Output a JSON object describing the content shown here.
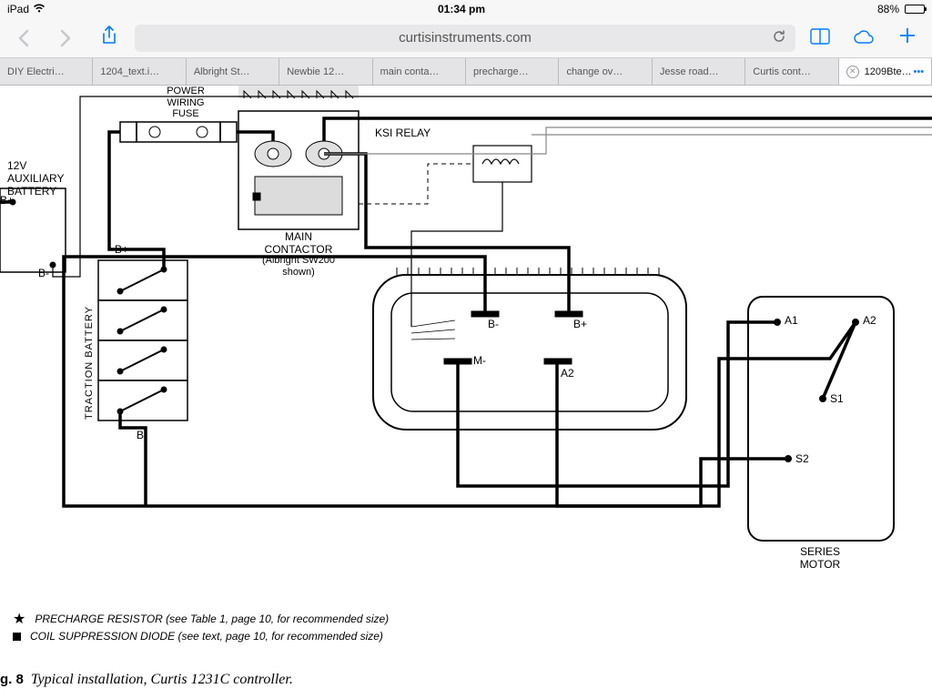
{
  "status": {
    "carrier": "iPad",
    "time": "01:34 pm",
    "battery_pct": "88%"
  },
  "toolbar": {
    "url": "curtisinstruments.com"
  },
  "tabs": [
    {
      "label": "DIY Electri…"
    },
    {
      "label": "1204_text.i…"
    },
    {
      "label": "Albright St…"
    },
    {
      "label": "Newbie 12…"
    },
    {
      "label": "main conta…"
    },
    {
      "label": "precharge…"
    },
    {
      "label": "change ov…"
    },
    {
      "label": "Jesse road…"
    },
    {
      "label": "Curtis cont…"
    },
    {
      "label": "1209Bte…",
      "active": true
    }
  ],
  "diagram": {
    "power_wiring_fuse": "POWER\nWIRING\nFUSE",
    "ksi_relay": "KSI RELAY",
    "aux_battery": "12V\nAUXILIARY\nBATTERY",
    "b_plus": "B+",
    "b_minus": "B-",
    "traction_battery": "TRACTION BATTERY",
    "main_contactor": "MAIN\nCONTACTOR",
    "main_contactor_sub": "(Albright SW200\nshown)",
    "ctrl_b_minus": "B-",
    "ctrl_b_plus": "B+",
    "ctrl_m_minus": "M-",
    "ctrl_a2": "A2",
    "motor_a1": "A1",
    "motor_a2": "A2",
    "motor_s1": "S1",
    "motor_s2": "S2",
    "series_motor": "SERIES\nMOTOR"
  },
  "legend": {
    "precharge": "PRECHARGE RESISTOR (see Table 1, page 10, for recommended size)",
    "coil": "COIL SUPPRESSION DIODE (see text, page 10, for recommended size)"
  },
  "caption": {
    "fig": "g. 8",
    "text": "Typical installation, Curtis 1231C controller."
  }
}
